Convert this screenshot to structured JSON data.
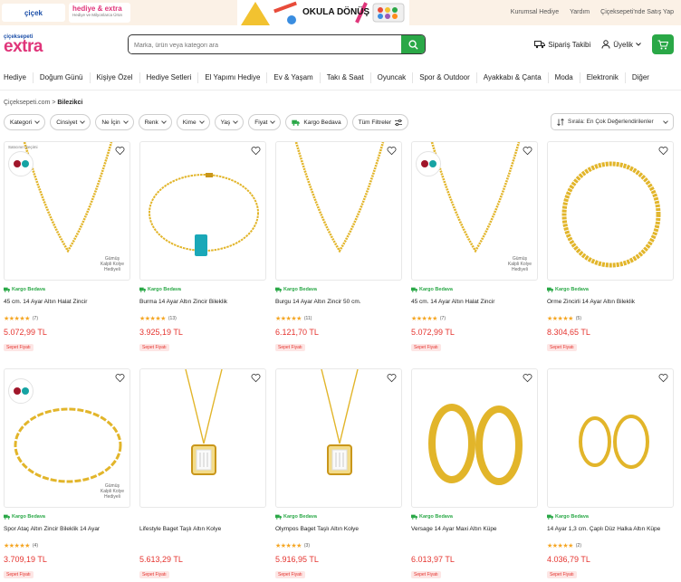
{
  "topbar": {
    "cicek_logo": "çiçek",
    "hediye_logo": "hediye & extra",
    "hediye_sub": "Hediye ve Milyonlarca Ürün",
    "banner_text": "OKULA DÖNÜŞ",
    "links": [
      "Kurumsal Hediye",
      "Yardım",
      "Çiçeksepeti'nde Satış Yap"
    ]
  },
  "header": {
    "logo_small": "çiçeksepeti",
    "logo_big": "extra",
    "search_placeholder": "Marka, ürün veya kategori ara",
    "order_tracking": "Sipariş Takibi",
    "account": "Üyelik"
  },
  "categories": [
    "Hediye",
    "Doğum Günü",
    "Kişiye Özel",
    "Hediye Setleri",
    "El Yapımı Hediye",
    "Ev & Yaşam",
    "Takı & Saat",
    "Oyuncak",
    "Spor & Outdoor",
    "Ayakkabı & Çanta",
    "Moda",
    "Elektronik",
    "Diğer"
  ],
  "breadcrumb": {
    "home": "Çiçeksepeti.com",
    "current": "Bilezikci"
  },
  "filters": [
    "Kategori",
    "Cinsiyet",
    "Ne İçin",
    "Renk",
    "Kime",
    "Yaş",
    "Fiyat"
  ],
  "filter_shipping": "Kargo Bedava",
  "filter_all": "Tüm Filtreler",
  "sort_label": "Sırala: En Çok Değerlendirilenler",
  "colors": {
    "brand_pink": "#e0357a",
    "green": "#2aa847",
    "price_red": "#e5342f",
    "star": "#f5a623"
  },
  "products": [
    {
      "name": "45 cm. 14 Ayar Altın Halat Zincir",
      "rating": "(7)",
      "price": "5.072,99 TL",
      "shipping": "Kargo Bedava",
      "badge": "Sepet Fiyatı",
      "seller_pick": "Satıcının Seçimi",
      "watermark": "Gümüş\nKalpli Kolye\nHediyeli",
      "image": "chain-v"
    },
    {
      "name": "Burma 14 Ayar Altın Zincir Bileklik",
      "rating": "(13)",
      "price": "3.925,19 TL",
      "shipping": "Kargo Bedava",
      "badge": "Sepet Fiyatı",
      "seller_pick": "",
      "watermark": "",
      "image": "bracelet-turq"
    },
    {
      "name": "Burgu 14 Ayar Altın Zincir 50 cm.",
      "rating": "(11)",
      "price": "6.121,70 TL",
      "shipping": "Kargo Bedava",
      "badge": "Sepet Fiyatı",
      "seller_pick": "",
      "watermark": "",
      "image": "chain-v"
    },
    {
      "name": "45 cm. 14 Ayar Altın Halat Zincir",
      "rating": "(7)",
      "price": "5.072,99 TL",
      "shipping": "Kargo Bedava",
      "badge": "Sepet Fiyatı",
      "seller_pick": "",
      "watermark": "Gümüş\nKalpli Kolye\nHediyeli",
      "image": "chain-v"
    },
    {
      "name": "Örme Zincirli 14 Ayar Altın Bileklik",
      "rating": "(5)",
      "price": "8.304,65 TL",
      "shipping": "Kargo Bedava",
      "badge": "Sepet Fiyatı",
      "seller_pick": "",
      "watermark": "",
      "image": "bracelet-thick"
    },
    {
      "name": "Spor Ataç Altın Zincir Bileklik 14 Ayar",
      "rating": "(4)",
      "price": "3.709,19 TL",
      "shipping": "Kargo Bedava",
      "badge": "Sepet Fiyatı",
      "seller_pick": "",
      "watermark": "Gümüş\nKalpli Kolye\nHediyeli",
      "image": "bracelet-link"
    },
    {
      "name": "Lifestyle Baget Taşlı Altın Kolye",
      "rating": "",
      "price": "5.613,29 TL",
      "shipping": "",
      "badge": "Sepet Fiyatı",
      "seller_pick": "",
      "watermark": "",
      "image": "pendant"
    },
    {
      "name": "Olympos Baget Taşlı Altın Kolye",
      "rating": "(3)",
      "price": "5.916,95 TL",
      "shipping": "Kargo Bedava",
      "badge": "Sepet Fiyatı",
      "seller_pick": "",
      "watermark": "",
      "image": "pendant"
    },
    {
      "name": "Versage 14 Ayar Maxi Altın Küpe",
      "rating": "",
      "price": "6.013,97 TL",
      "shipping": "Kargo Bedava",
      "badge": "Sepet Fiyatı",
      "seller_pick": "",
      "watermark": "",
      "image": "hoops-big"
    },
    {
      "name": "14 Ayar 1,3 cm. Çaplı Düz Halka Altın Küpe",
      "rating": "(2)",
      "price": "4.036,79 TL",
      "shipping": "Kargo Bedava",
      "badge": "Sepet Fiyatı",
      "seller_pick": "",
      "watermark": "",
      "image": "hoops-small"
    }
  ]
}
